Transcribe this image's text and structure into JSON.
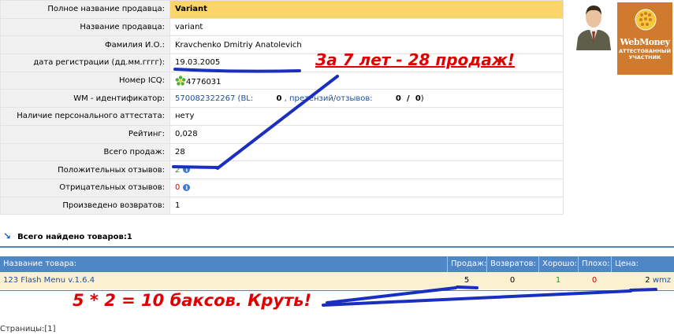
{
  "seller_info": {
    "rows": [
      {
        "label": "Полное название продавца:",
        "value": "Variant"
      },
      {
        "label": "Название продавца:",
        "value": "variant"
      },
      {
        "label": "Фамилия И.О.:",
        "value": "Kravchenko Dmitriy Anatolevich"
      },
      {
        "label": "дата регистрации (дд.мм.гггг):",
        "value": "19.03.2005"
      },
      {
        "label": "Номер ICQ:",
        "value": "4776031"
      },
      {
        "label": "WM - идентификатор:",
        "value": "570082322267",
        "bl_prefix": "(BL:",
        "bl_value": "0",
        "claims_label": ", претензий/отзывов:",
        "claims_a": "0",
        "claims_sep": "/",
        "claims_b": "0",
        "close": ")"
      },
      {
        "label": "Наличие персонального аттестата:",
        "value": "нету"
      },
      {
        "label": "Рейтинг:",
        "value": "0,028"
      },
      {
        "label": "Всего продаж:",
        "value": "28"
      },
      {
        "label": "Положительных отзывов:",
        "value": "2"
      },
      {
        "label": "Отрицательных отзывов:",
        "value": "0"
      },
      {
        "label": "Произведено возвратов:",
        "value": "1"
      }
    ]
  },
  "webmoney_badge": {
    "logo": "WebMoney",
    "line1": "АТТЕСТОВАННЫЙ",
    "line2": "УЧАСТНИК"
  },
  "annotations": {
    "top": "За 7 лет - 28 продаж!",
    "bottom": "5 * 2 = 10 баксов. Круть!"
  },
  "found": {
    "text": "Всего найдено товаров:1"
  },
  "goods_table": {
    "headers": [
      "Название товара:",
      "Продаж:",
      "Возвратов:",
      "Хорошо:",
      "Плохо:",
      "Цена:"
    ],
    "row": {
      "name": "123 Flash Menu v.1.6.4",
      "sales": "5",
      "returns": "0",
      "good": "1",
      "bad": "0",
      "price": "2",
      "currency": "wmz"
    }
  },
  "pagination": {
    "text": "Страницы:[1]"
  },
  "colors": {
    "highlight": "#fbd46a",
    "header_blue": "#4f86c6",
    "annotation_red": "#e00000",
    "annotation_blue": "#1a2fc0",
    "row_bg": "#fbf0d0"
  },
  "icons": [
    "icq-flower-icon",
    "info-icon",
    "avatar-icon",
    "webmoney-logo",
    "arrow-down-right-icon"
  ]
}
